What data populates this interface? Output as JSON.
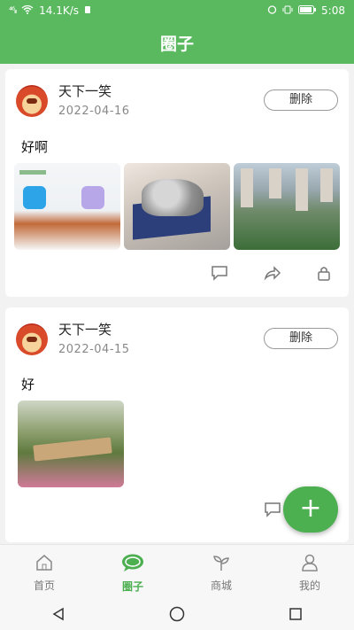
{
  "status_bar": {
    "signal": "⁴⁶ᵢₗₗ",
    "speed": "14.1K/s",
    "time": "5:08"
  },
  "app_bar": {
    "title": "圈子"
  },
  "posts": [
    {
      "username": "天下一笑",
      "date": "2022-04-16",
      "delete_label": "删除",
      "content": "好啊"
    },
    {
      "username": "天下一笑",
      "date": "2022-04-15",
      "delete_label": "删除",
      "content": "好"
    }
  ],
  "tabs": [
    {
      "label": "首页",
      "icon": "home-icon"
    },
    {
      "label": "圈子",
      "icon": "chat-bubble-icon",
      "active": true
    },
    {
      "label": "商城",
      "icon": "sprout-icon"
    },
    {
      "label": "我的",
      "icon": "person-icon"
    }
  ],
  "fab": {
    "label": "+"
  },
  "colors": {
    "primary": "#5ab95f",
    "fab": "#4caf50"
  }
}
